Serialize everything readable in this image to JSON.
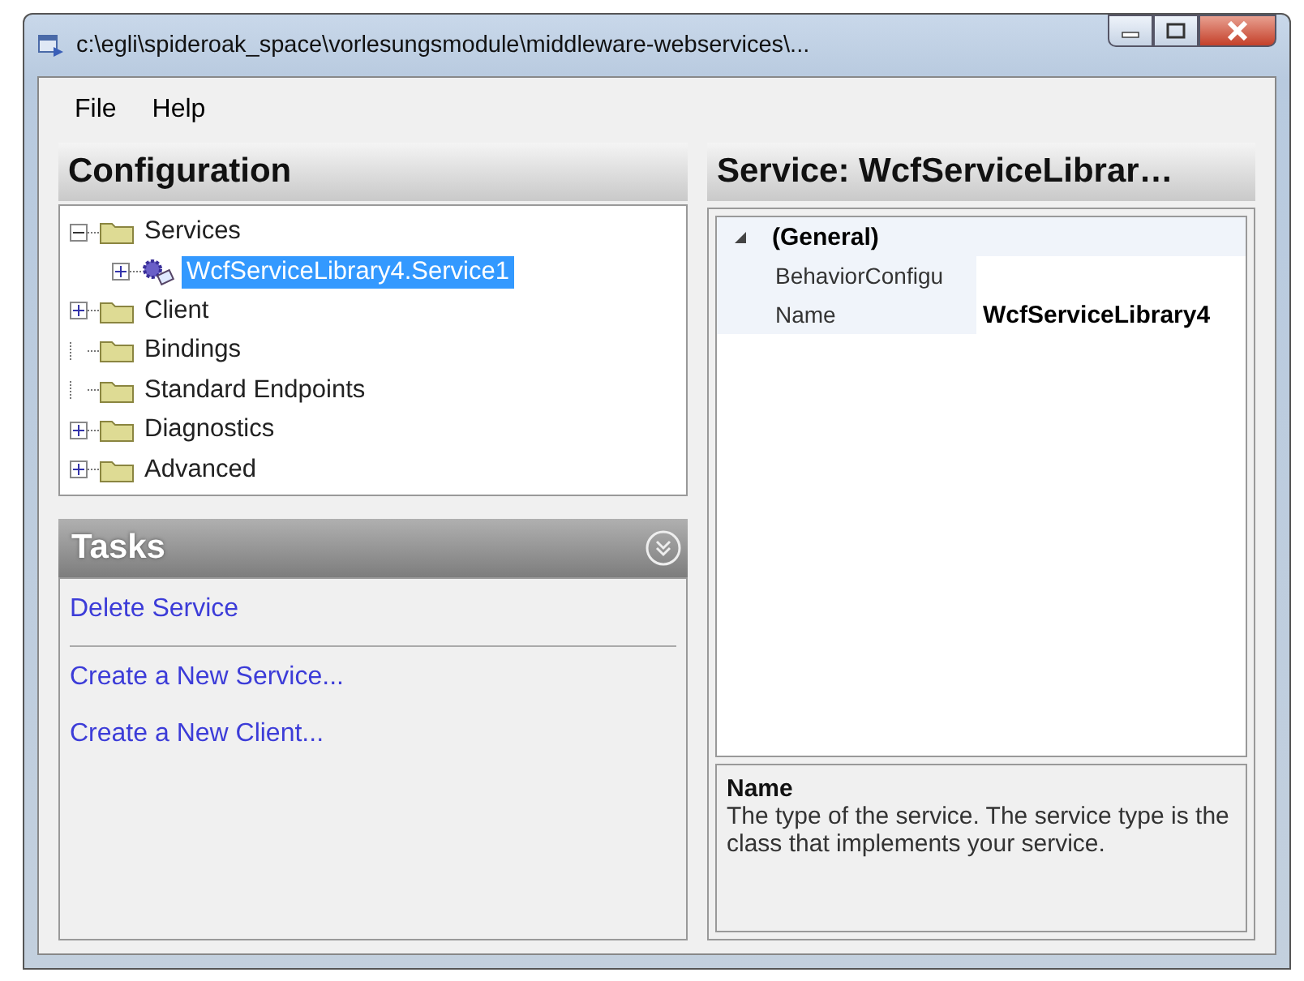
{
  "window": {
    "title": "c:\\egli\\spideroak_space\\vorlesungsmodule\\middleware-webservices\\..."
  },
  "menu": [
    "File",
    "Help"
  ],
  "configuration": {
    "title": "Configuration",
    "tree": [
      {
        "label": "Services",
        "kind": "folder",
        "expanded": true,
        "selected": false,
        "children": [
          {
            "label": "WcfServiceLibrary4.Service1",
            "kind": "service",
            "expanded": false,
            "selected": true
          }
        ]
      },
      {
        "label": "Client",
        "kind": "folder",
        "expanded": false,
        "selected": false
      },
      {
        "label": "Bindings",
        "kind": "folder",
        "selected": false
      },
      {
        "label": "Standard Endpoints",
        "kind": "folder",
        "selected": false
      },
      {
        "label": "Diagnostics",
        "kind": "folder",
        "expanded": false,
        "selected": false
      },
      {
        "label": "Advanced",
        "kind": "folder",
        "expanded": false,
        "selected": false
      }
    ]
  },
  "tasks": {
    "title": "Tasks",
    "groups": [
      [
        "Delete Service"
      ],
      [
        "Create a New Service...",
        "Create a New Client..."
      ]
    ]
  },
  "service": {
    "title": "Service:  WcfServiceLibrar…",
    "grid": [
      {
        "category": "(General)",
        "expanded": true,
        "rows": [
          {
            "name": "BehaviorConfigu",
            "bold": false
          },
          {
            "name": "Name",
            "value": "WcfServiceLibrary4",
            "bold": true
          }
        ]
      }
    ],
    "description": {
      "title": "Name",
      "text": "The type of the service. The service type is the class that implements your service."
    }
  }
}
